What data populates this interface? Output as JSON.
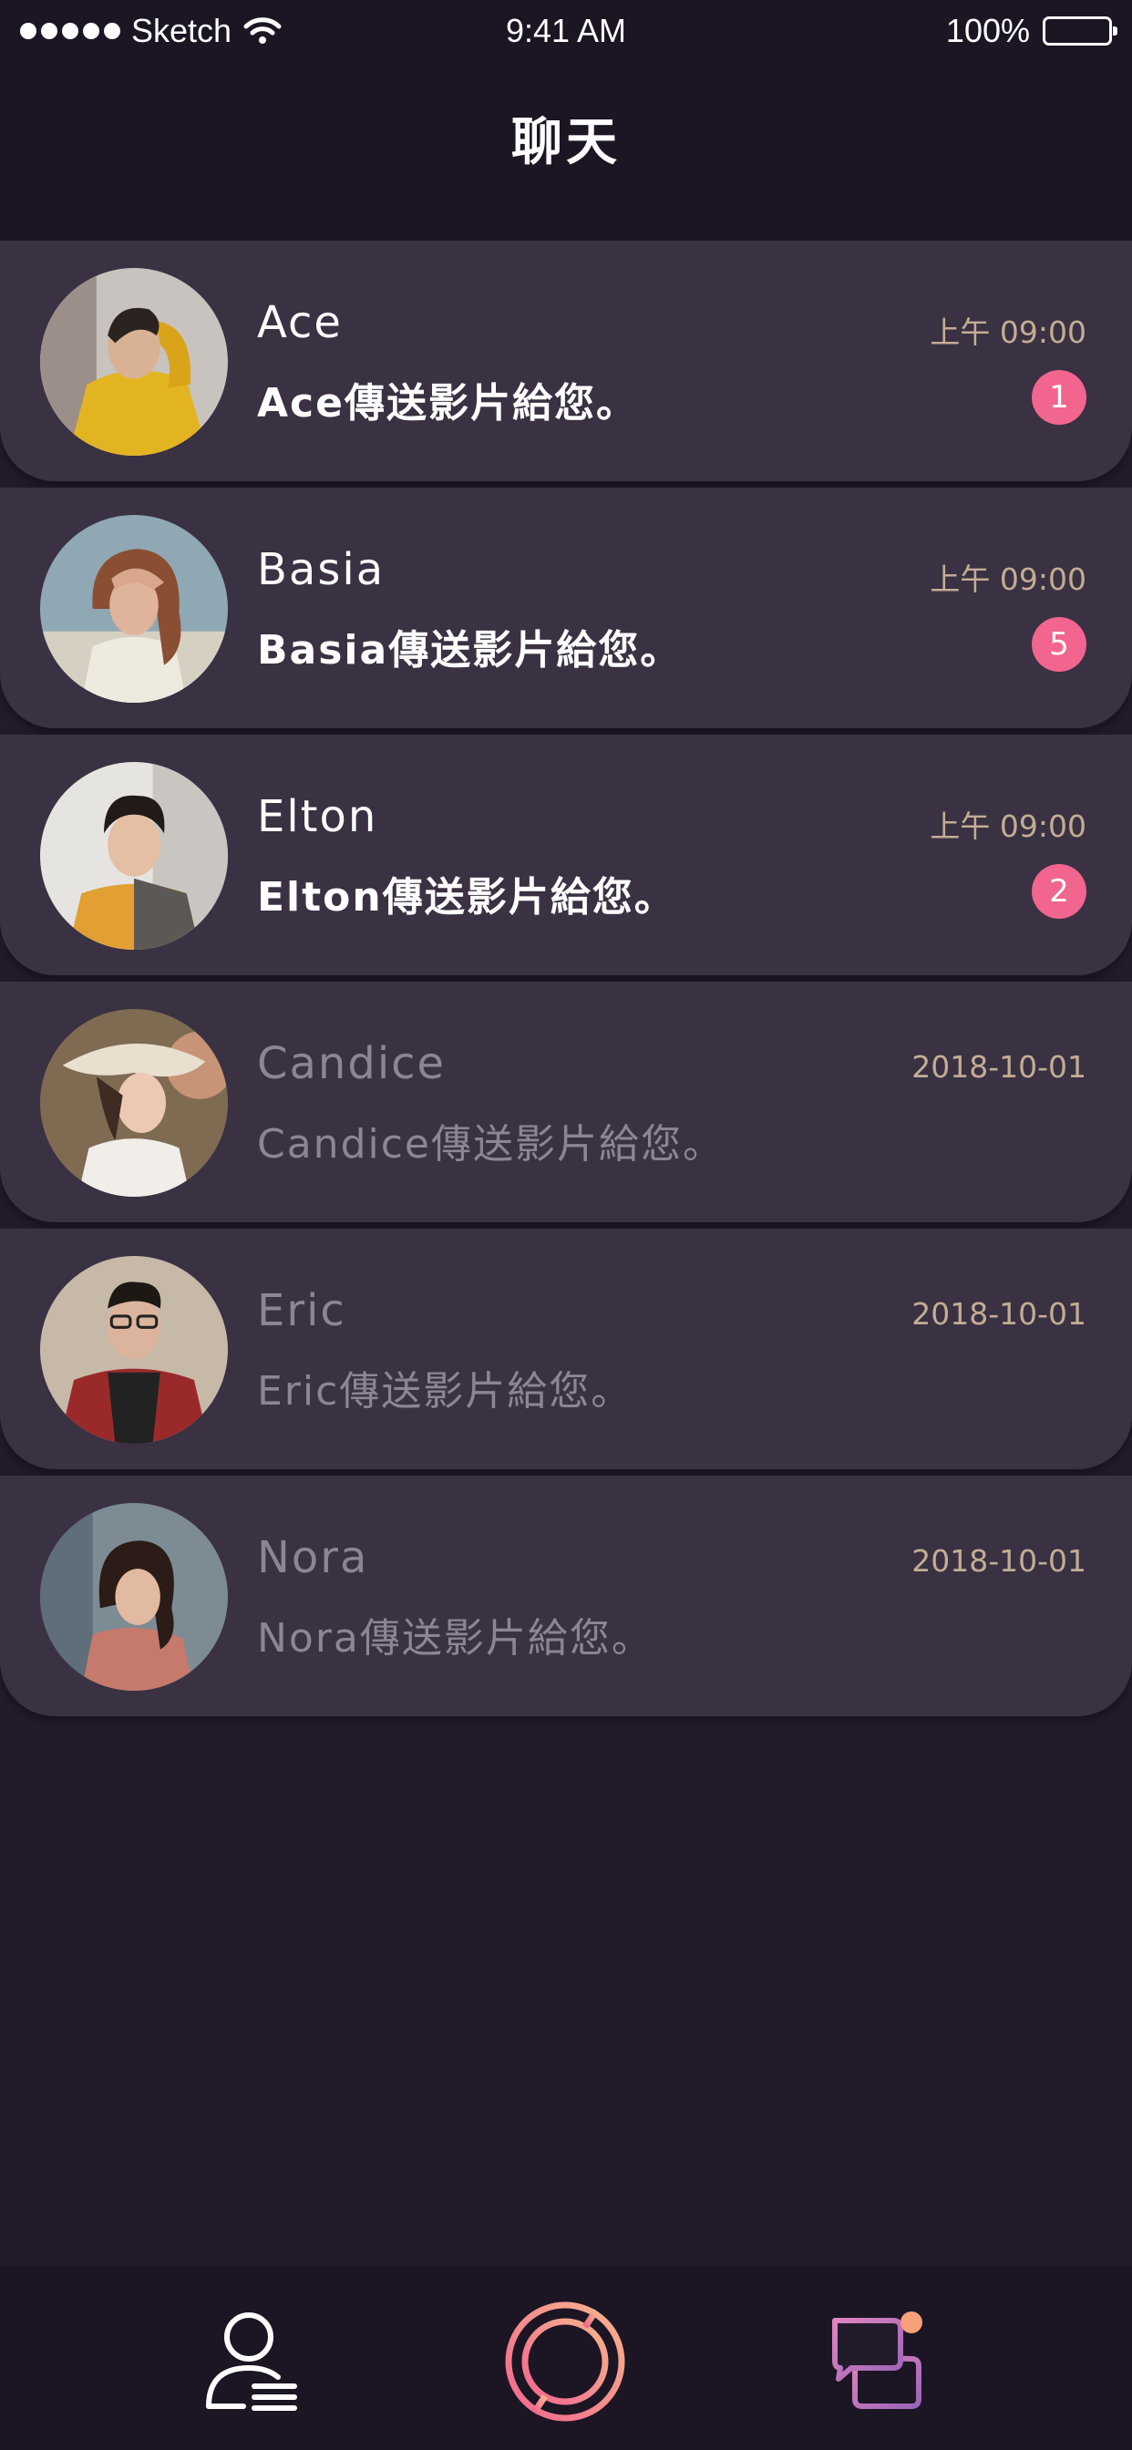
{
  "status_bar": {
    "carrier": "Sketch",
    "time": "9:41 AM",
    "battery": "100%"
  },
  "header": {
    "title": "聊天"
  },
  "chats": [
    {
      "name": "Ace",
      "time": "上午 09:00",
      "preview": "Ace傳送影片給您。",
      "unread": "1",
      "state": "unread"
    },
    {
      "name": "Basia",
      "time": "上午 09:00",
      "preview": "Basia傳送影片給您。",
      "unread": "5",
      "state": "unread"
    },
    {
      "name": "Elton",
      "time": "上午 09:00",
      "preview": "Elton傳送影片給您。",
      "unread": "2",
      "state": "unread"
    },
    {
      "name": "Candice",
      "time": "2018-10-01",
      "preview": "Candice傳送影片給您。",
      "state": "read"
    },
    {
      "name": "Eric",
      "time": "2018-10-01",
      "preview": "Eric傳送影片給您。",
      "state": "read"
    },
    {
      "name": "Nora",
      "time": "2018-10-01",
      "preview": "Nora傳送影片給您。",
      "state": "read"
    }
  ],
  "tab_bar": {
    "tabs": [
      {
        "icon": "profile-list-icon"
      },
      {
        "icon": "camera-ring-icon"
      },
      {
        "icon": "chat-bubbles-icon"
      }
    ]
  },
  "colors": {
    "background": "#221b2c",
    "card": "#3a3143",
    "badge": "#f1658e",
    "time_text": "#c3ad93",
    "muted_text": "#8d8594",
    "accent_gradient_start": "#f1658e",
    "accent_gradient_end": "#f7b58c"
  }
}
